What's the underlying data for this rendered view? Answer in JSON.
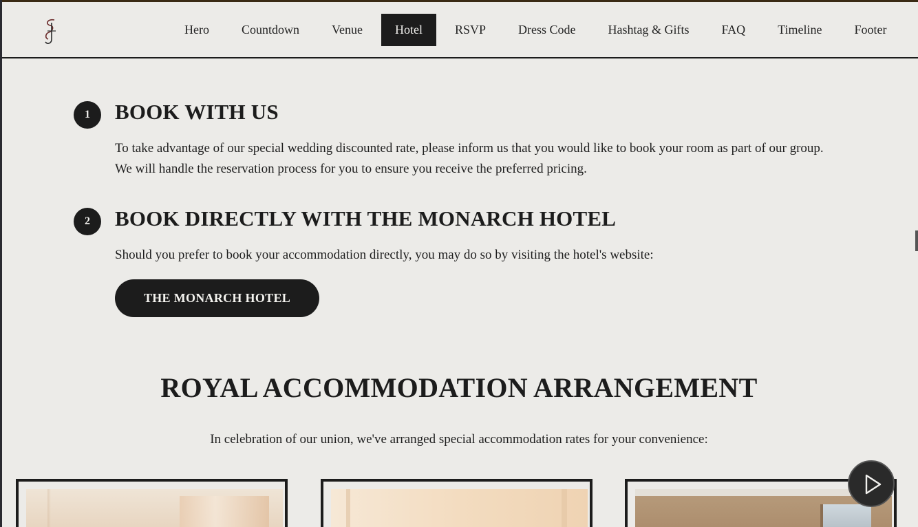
{
  "nav": {
    "logo_icon": "monogram-logo",
    "items": [
      {
        "label": "Hero",
        "active": false
      },
      {
        "label": "Countdown",
        "active": false
      },
      {
        "label": "Venue",
        "active": false
      },
      {
        "label": "Hotel",
        "active": true
      },
      {
        "label": "RSVP",
        "active": false
      },
      {
        "label": "Dress Code",
        "active": false
      },
      {
        "label": "Hashtag & Gifts",
        "active": false
      },
      {
        "label": "FAQ",
        "active": false
      },
      {
        "label": "Timeline",
        "active": false
      },
      {
        "label": "Footer",
        "active": false
      }
    ]
  },
  "steps": [
    {
      "number": "1",
      "title": "BOOK WITH US",
      "text": "To take advantage of our special wedding discounted rate, please inform us that you would like to book your room as part of our group. We will handle the reservation process for you to ensure you receive the preferred pricing."
    },
    {
      "number": "2",
      "title": "BOOK DIRECTLY WITH THE MONARCH HOTEL",
      "text": "Should you prefer to book your accommodation directly, you may do so by visiting the hotel's website:"
    }
  ],
  "hotel_button": {
    "label": "THE MONARCH HOTEL"
  },
  "accommodation": {
    "title": "ROYAL ACCOMMODATION ARRANGEMENT",
    "subtitle": "In celebration of our union, we've arranged special accommodation rates for your convenience:",
    "cards": [
      "hotel-room-image-1",
      "hotel-room-image-2",
      "hotel-room-image-3"
    ]
  },
  "player": {
    "icon": "play-icon"
  },
  "colors": {
    "background": "#ecebe8",
    "ink": "#1c1c1c",
    "accent": "#3a2a14"
  }
}
